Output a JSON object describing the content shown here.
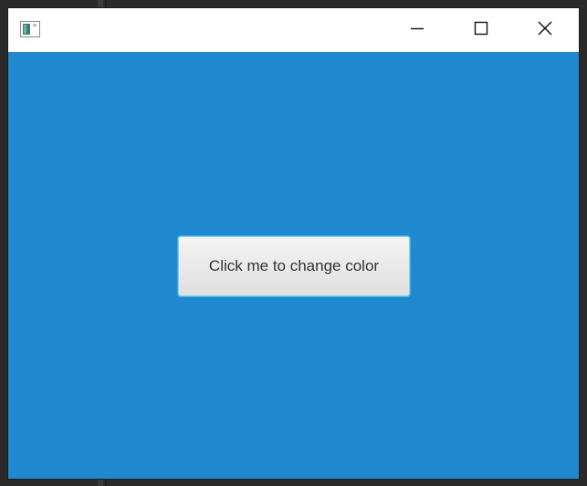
{
  "window": {
    "icon": "java-app-icon"
  },
  "titlebar": {
    "controls": [
      "minimize-icon",
      "maximize-icon",
      "close-icon"
    ]
  },
  "content": {
    "background_color": "#1f88ce",
    "button_label": "Click me to change color"
  }
}
